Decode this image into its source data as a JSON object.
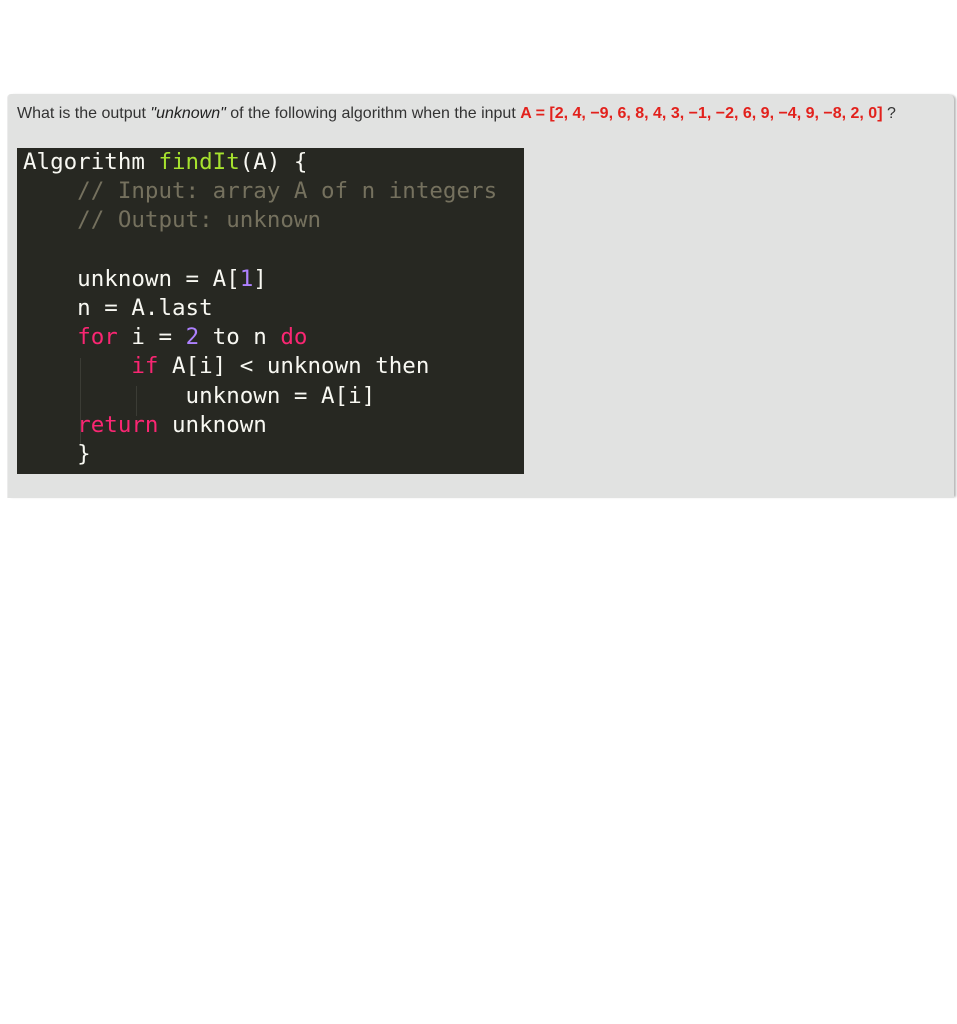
{
  "question": {
    "prefix": "What is the output ",
    "quoted_term": "\"unknown\"",
    "middle": " of the following algorithm when the input ",
    "input_highlight": "A = [2, 4, −9, 6, 8, 4, 3, −1, −2, 6, 9, −4, 9, −8, 2, 0]",
    "suffix": " ?"
  },
  "code": {
    "l1_keyword": "Algorithm ",
    "l1_fn": "findIt",
    "l1_rest": "(A) {",
    "l2_comment": "    // Input: array A of n integers",
    "l3_comment": "    // Output: unknown",
    "l5_a": "    unknown = A[",
    "l5_num": "1",
    "l5_b": "]",
    "l6": "    n = A.last",
    "l7_indent": "    ",
    "l7_for": "for",
    "l7_a": " i = ",
    "l7_num": "2",
    "l7_b": " to n ",
    "l7_do": "do",
    "l8_indent": "        ",
    "l8_if": "if",
    "l8_rest": " A[i] < unknown then",
    "l9": "            unknown = A[i]",
    "l10_indent": "    ",
    "l10_return": "return",
    "l10_rest": " unknown",
    "l11": "    }"
  },
  "colors": {
    "highlight": "#e2211c",
    "code_bg": "#272822",
    "function_name": "#a6e22e",
    "comment": "#75715e",
    "keyword": "#f92672",
    "number": "#ae81ff"
  }
}
